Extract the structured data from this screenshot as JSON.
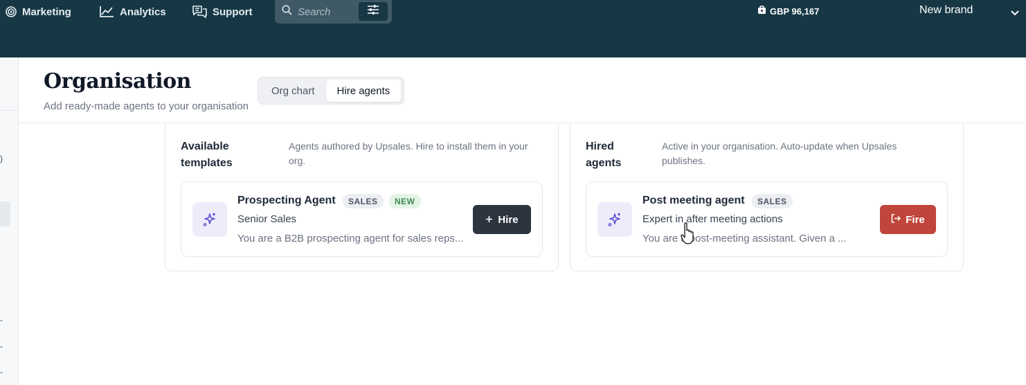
{
  "topbar": {
    "nav": [
      {
        "label": "Marketing",
        "icon": "marketing-icon"
      },
      {
        "label": "Analytics",
        "icon": "chart-line-icon"
      },
      {
        "label": "Support",
        "icon": "chat-bubbles-icon"
      }
    ],
    "search": {
      "placeholder": "Search"
    },
    "balance": "GBP 96,167",
    "brand": "New brand"
  },
  "sidebar": {
    "marks": [
      ")",
      "-",
      "-",
      "-"
    ]
  },
  "header": {
    "title": "Organisation",
    "subtitle": "Add ready-made agents to your organisation",
    "tabs": [
      {
        "label": "Org chart",
        "active": false
      },
      {
        "label": "Hire agents",
        "active": true
      }
    ]
  },
  "available": {
    "title": "Available templates",
    "description": "Agents authored by Upsales. Hire to install them in your org.",
    "cards": [
      {
        "name": "Prospecting Agent",
        "badges": [
          "SALES",
          "NEW"
        ],
        "role": "Senior Sales",
        "description": "You are a B2B prospecting agent for sales reps...",
        "action": "Hire"
      }
    ]
  },
  "hired": {
    "title": "Hired agents",
    "description": "Active in your organisation. Auto-update when Upsales publishes.",
    "cards": [
      {
        "name": "Post meeting agent",
        "badges": [
          "SALES"
        ],
        "role": "Expert in after meeting actions",
        "description": "You are a post-meeting assistant. Given a ...",
        "action": "Fire"
      }
    ]
  },
  "colors": {
    "topbar": "#173745",
    "hire_button": "#2c3440",
    "fire_button": "#c0453a",
    "agent_icon_bg": "#eeecfb",
    "agent_icon": "#5b4fcf"
  }
}
